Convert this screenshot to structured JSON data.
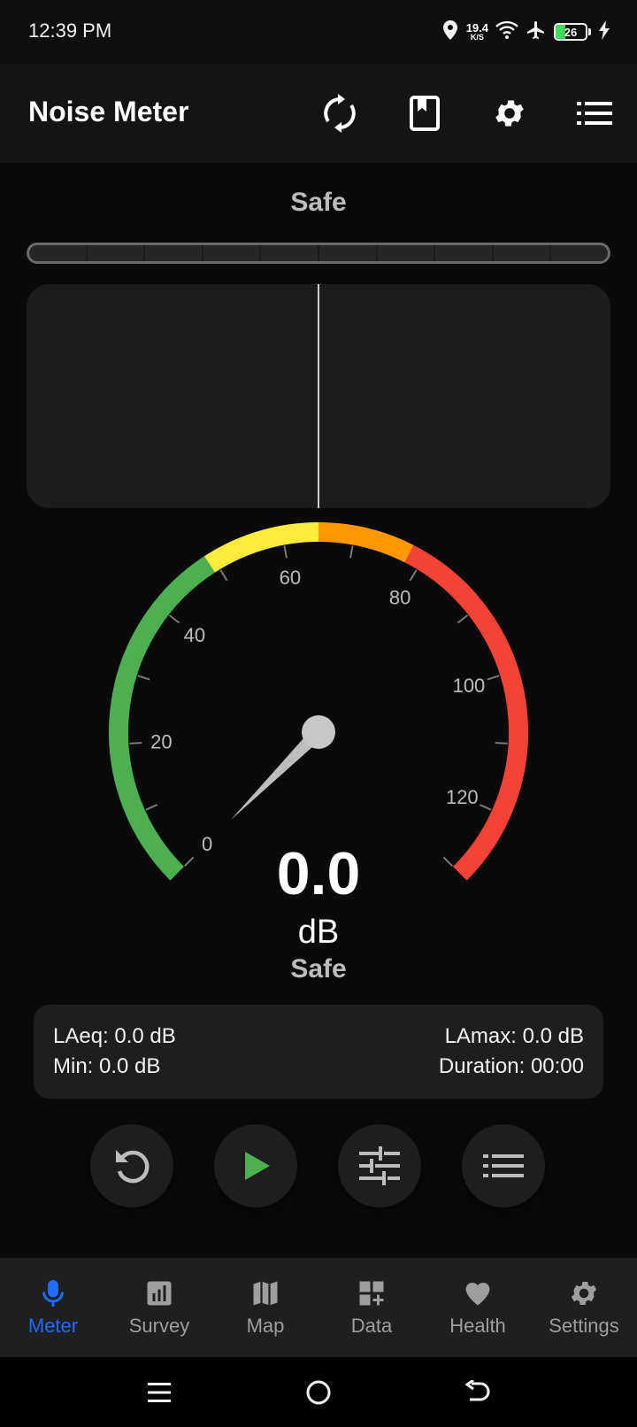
{
  "status_bar": {
    "time": "12:39 PM",
    "net_speed_value": "19.4",
    "net_speed_unit": "K/S",
    "battery_level": "26"
  },
  "app_bar": {
    "title": "Noise Meter",
    "icons": [
      "refresh-icon",
      "bookmark-icon",
      "gear-icon",
      "list-icon"
    ]
  },
  "level": {
    "label": "Safe",
    "segments": 10,
    "fill_fraction": 0
  },
  "gauge": {
    "min": 0,
    "max": 130,
    "needle_value": 0,
    "tick_labels": [
      "0",
      "20",
      "40",
      "60",
      "80",
      "100",
      "120"
    ],
    "zone_colors": {
      "safe": "#4caf50",
      "moderate": "#ffeb3b",
      "loud": "#ff9800",
      "danger": "#f44336"
    }
  },
  "reading": {
    "value": "0.0",
    "unit": "dB",
    "status": "Safe"
  },
  "stats": {
    "laeq": "LAeq: 0.0 dB",
    "lamax": "LAmax: 0.0 dB",
    "min": "Min: 0.0 dB",
    "duration": "Duration: 00:00"
  },
  "controls": [
    "reset-icon",
    "play-icon",
    "sliders-icon",
    "list-icon"
  ],
  "bottom_nav": {
    "items": [
      {
        "label": "Meter",
        "icon": "mic-icon",
        "active": true
      },
      {
        "label": "Survey",
        "icon": "chart-icon",
        "active": false
      },
      {
        "label": "Map",
        "icon": "map-icon",
        "active": false
      },
      {
        "label": "Data",
        "icon": "dashboard-add-icon",
        "active": false
      },
      {
        "label": "Health",
        "icon": "heart-icon",
        "active": false
      },
      {
        "label": "Settings",
        "icon": "gear-icon",
        "active": false
      }
    ]
  },
  "colors": {
    "accent": "#1e6bff",
    "play": "#4caf50",
    "background": "#0a0a0a"
  }
}
